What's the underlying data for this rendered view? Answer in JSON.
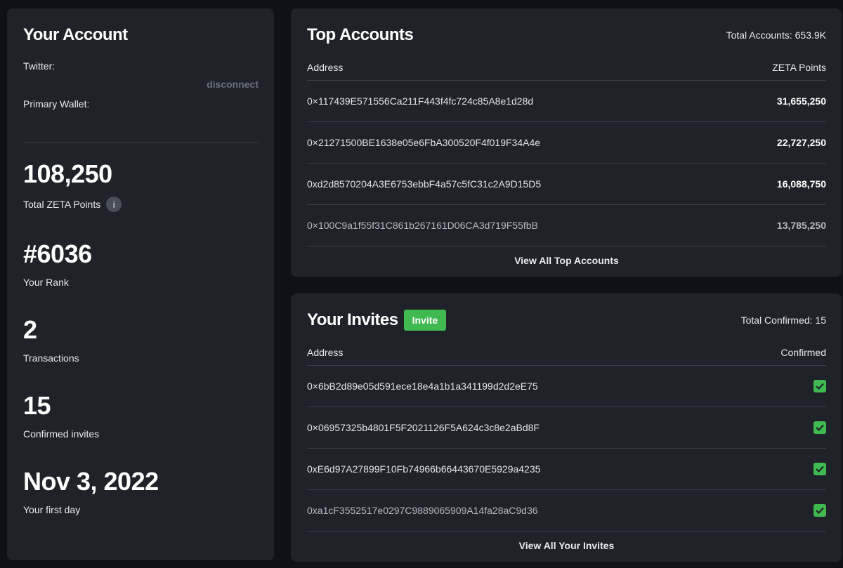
{
  "account": {
    "title": "Your Account",
    "twitter_label": "Twitter:",
    "disconnect_label": "disconnect",
    "wallet_label": "Primary Wallet:",
    "stats": [
      {
        "value": "108,250",
        "label": "Total ZETA Points",
        "info_icon": "info-icon"
      },
      {
        "value": "#6036",
        "label": "Your Rank"
      },
      {
        "value": "2",
        "label": "Transactions"
      },
      {
        "value": "15",
        "label": "Confirmed invites"
      },
      {
        "value": "Nov 3, 2022",
        "label": "Your first day"
      }
    ]
  },
  "top_accounts": {
    "title": "Top Accounts",
    "total": "Total Accounts: 653.9K",
    "col_address": "Address",
    "col_points": "ZETA Points",
    "rows": [
      {
        "address": "0×117439E571556Ca211F443f4fc724c85A8e1d28d",
        "points": "31,655,250"
      },
      {
        "address": "0×21271500BE1638e05e6FbA300520F4f019F34A4e",
        "points": "22,727,250"
      },
      {
        "address": "0xd2d8570204A3E6753ebbF4a57c5fC31c2A9D15D5",
        "points": "16,088,750"
      },
      {
        "address": "0×100C9a1f55f31C861b267161D06CA3d719F55fbB",
        "points": "13,785,250"
      }
    ],
    "view_all": "View All Top Accounts"
  },
  "invites": {
    "title": "Your Invites",
    "invite_button": "Invite",
    "total": "Total Confirmed: 15",
    "col_address": "Address",
    "col_confirmed": "Confirmed",
    "rows": [
      {
        "address": "0×6bB2d89e05d591ece18e4a1b1a341199d2d2eE75",
        "confirmed": true
      },
      {
        "address": "0×06957325b4801F5F2021126F5A624c3c8e2aBd8F",
        "confirmed": true
      },
      {
        "address": "0xE6d97A27899F10Fb74966b66443670E5929a4235",
        "confirmed": true
      },
      {
        "address": "0xa1cF3552517e0297C9889065909A14fa28aC9d36",
        "confirmed": true
      }
    ],
    "view_all": "View All Your Invites"
  },
  "colors": {
    "background": "#0e1117",
    "card": "#1f2229",
    "accent_green": "#3fb950",
    "muted": "#6b7079"
  }
}
